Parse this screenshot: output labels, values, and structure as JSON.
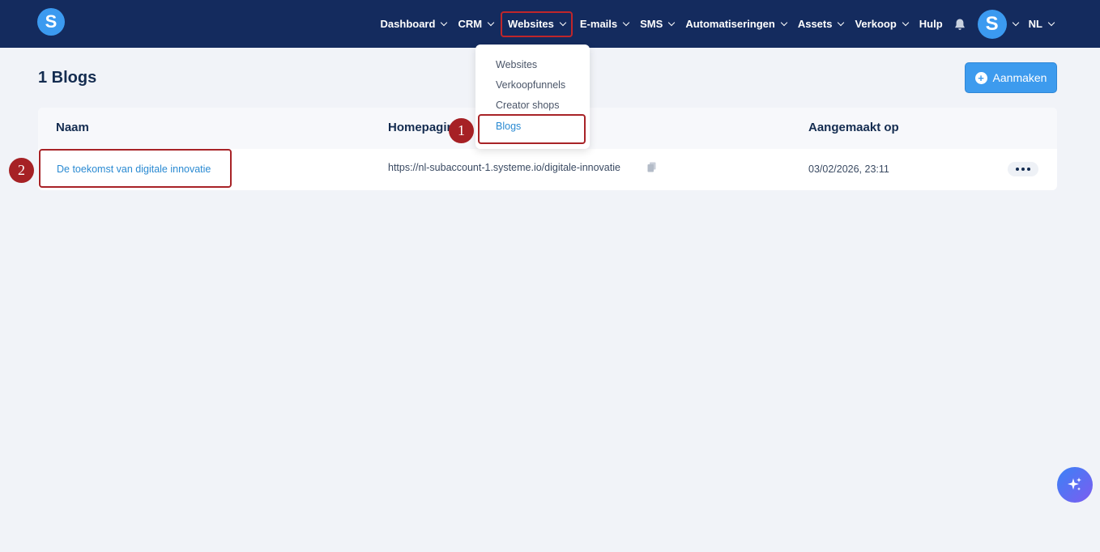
{
  "header": {
    "logo_letter": "S",
    "nav": [
      {
        "label": "Dashboard"
      },
      {
        "label": "CRM"
      },
      {
        "label": "Websites"
      },
      {
        "label": "E-mails"
      },
      {
        "label": "SMS"
      },
      {
        "label": "Automatiseringen"
      },
      {
        "label": "Assets"
      },
      {
        "label": "Verkoop"
      }
    ],
    "help_label": "Hulp",
    "avatar_letter": "S",
    "language": "NL"
  },
  "dropdown": {
    "items": [
      "Websites",
      "Verkoopfunnels",
      "Creator shops",
      "Blogs"
    ]
  },
  "page": {
    "title": "1 Blogs",
    "create_label": "Aanmaken"
  },
  "table": {
    "headers": [
      "Naam",
      "Homepagina",
      "Aangemaakt op"
    ],
    "rows": [
      {
        "name": "De toekomst van digitale innovatie",
        "url": "https://nl-subaccount-1.systeme.io/digitale-innovatie",
        "created": "03/02/2026, 23:11"
      }
    ]
  },
  "markers": [
    "1",
    "2"
  ],
  "colors": {
    "topbar": "#142b5e",
    "accent": "#3d9bee",
    "marker": "#a62125"
  }
}
